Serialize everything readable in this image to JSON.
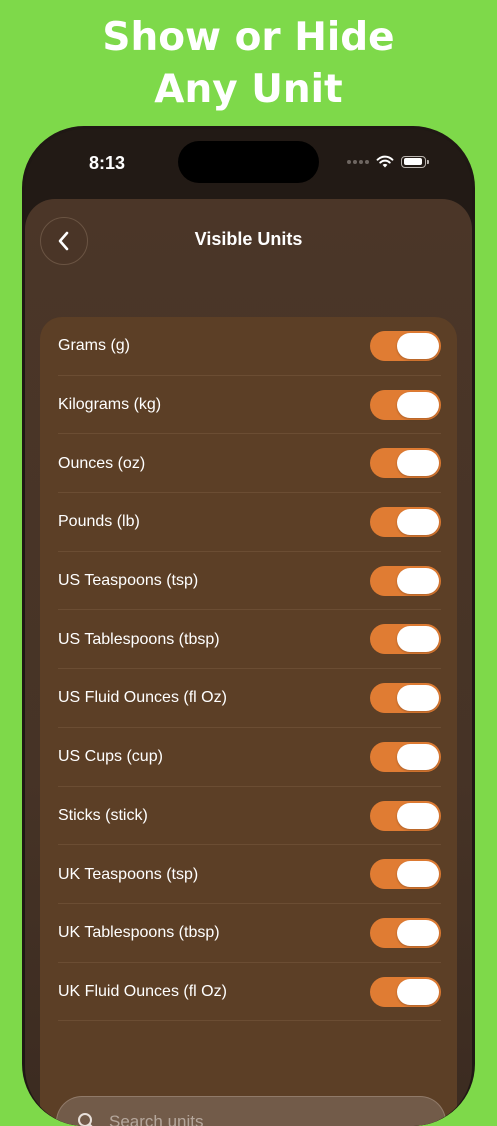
{
  "promo": {
    "line1": "Show or Hide",
    "line2": "Any Unit"
  },
  "status_bar": {
    "time": "8:13"
  },
  "nav": {
    "title": "Visible Units"
  },
  "units": [
    {
      "label": "Grams (g)",
      "enabled": true
    },
    {
      "label": "Kilograms (kg)",
      "enabled": true
    },
    {
      "label": "Ounces (oz)",
      "enabled": true
    },
    {
      "label": "Pounds (lb)",
      "enabled": true
    },
    {
      "label": "US Teaspoons (tsp)",
      "enabled": true
    },
    {
      "label": "US Tablespoons (tbsp)",
      "enabled": true
    },
    {
      "label": "US Fluid Ounces (fl Oz)",
      "enabled": true
    },
    {
      "label": "US Cups (cup)",
      "enabled": true
    },
    {
      "label": "Sticks (stick)",
      "enabled": true
    },
    {
      "label": "UK Teaspoons (tsp)",
      "enabled": true
    },
    {
      "label": "UK Tablespoons (tbsp)",
      "enabled": true
    },
    {
      "label": "UK Fluid Ounces (fl Oz)",
      "enabled": true
    }
  ],
  "search": {
    "placeholder": "Search units"
  },
  "colors": {
    "background": "#7ed94a",
    "accent": "#e07c33",
    "card": "#5c3f26"
  },
  "icons": {
    "back": "chevron-left-icon",
    "search": "search-icon",
    "wifi": "wifi-icon",
    "battery": "battery-icon",
    "signal": "cellular-signal-icon"
  }
}
